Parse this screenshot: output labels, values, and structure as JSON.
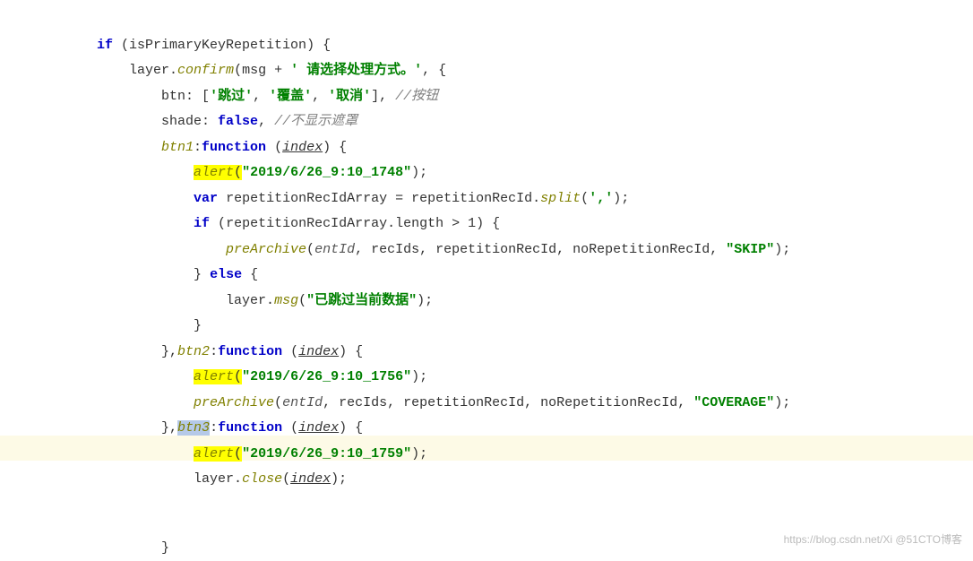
{
  "code": {
    "if_kw": "if",
    "cond_open": " (",
    "cond_var": "isPrimaryKeyRepetition",
    "cond_close": ") {",
    "layer": "layer",
    "dot": ".",
    "confirm": "confirm",
    "open_paren": "(",
    "msg_var": "msg",
    "plus": " + ",
    "msg_str": "' 请选择处理方式。'",
    "comma_brace": ", {",
    "btn_key": "btn",
    "colon": ": ",
    "btn_arr_open": "[",
    "btn1_str": "'跳过'",
    "sep": ", ",
    "btn2_str": "'覆盖'",
    "btn3_str": "'取消'",
    "btn_arr_close": "], ",
    "btn_cmt": "//按钮",
    "shade_key": "shade",
    "false_kw": "false",
    "shade_after": ", ",
    "shade_cmt": "//不显示遮罩",
    "btn1_key": "btn1",
    "colon2": ":",
    "function_kw": "function",
    "space": " ",
    "index_param": "index",
    "fn_header_close": ") {",
    "alert_fn": "alert",
    "alert1_str": "\"2019/6/26_9:10_1748\"",
    "close_stmt": ");",
    "var_kw": "var",
    "repArr": "repetitionRecIdArray",
    "eq": " = ",
    "repId": "repetitionRecId",
    "split_fn": "split",
    "split_arg": "','",
    "length_prop": "length",
    "gt": " > ",
    "one": "1",
    "preArchive_fn": "preArchive",
    "entId": "entId",
    "recIds": "recIds",
    "noRepId": "noRepetitionRecId",
    "skip_str": "\"SKIP\"",
    "else_kw": "else",
    "msg_fn": "msg",
    "skipped_str": "\"已跳过当前数据\"",
    "brace_close": "}",
    "btn2_key": "btn2",
    "alert2_str": "\"2019/6/26_9:10_1756\"",
    "cov_str": "\"COVERAGE\"",
    "btn3_key": "btn3",
    "alert3_str": "\"2019/6/26_9:10_1759\"",
    "close_fn": "close",
    "watermark": "https://blog.csdn.net/Xi   @51CTO博客"
  }
}
